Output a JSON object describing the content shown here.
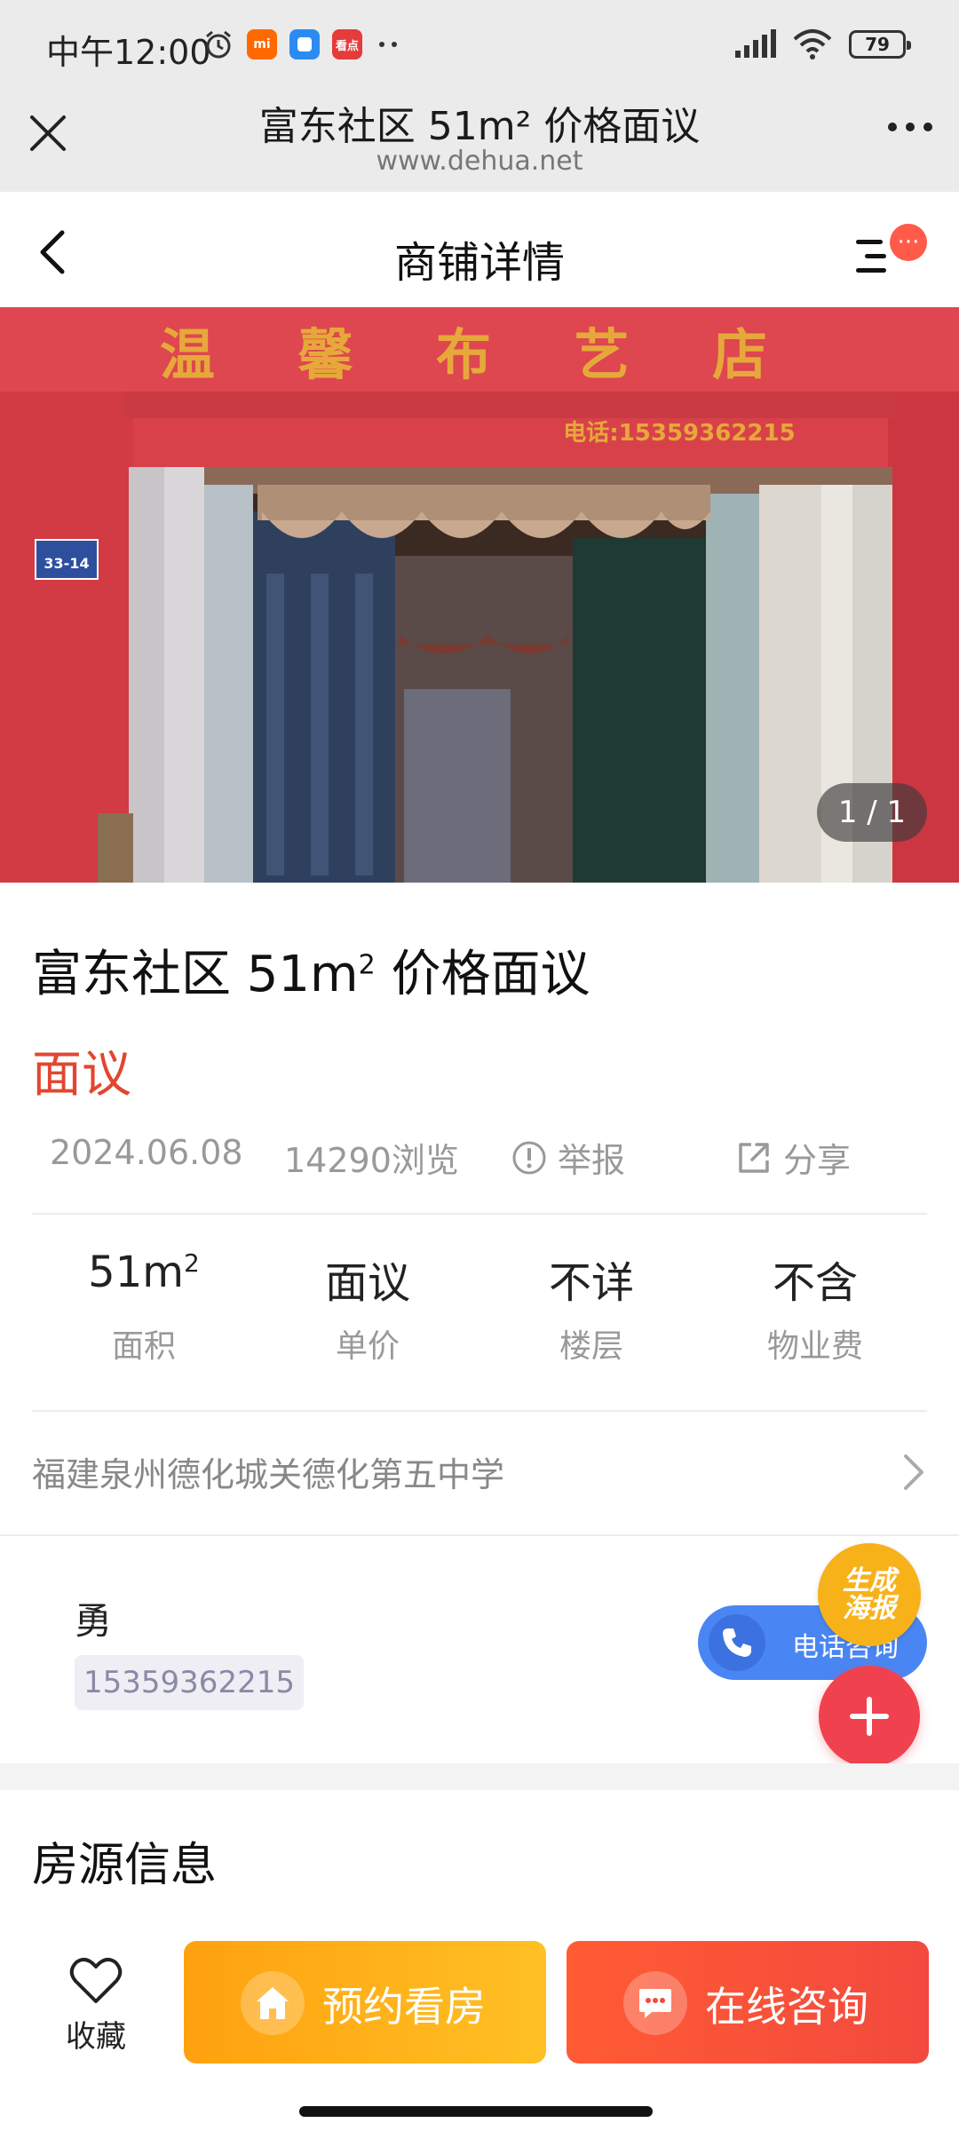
{
  "status_bar": {
    "time": "中午12:00",
    "apps": [
      {
        "icon": "mi-app-icon",
        "label": "mi",
        "color": "#ff6900"
      },
      {
        "icon": "blue-app-icon",
        "label": "",
        "color": "#2b8bf2"
      },
      {
        "icon": "kandian-app-icon",
        "label": "看点",
        "color": "#e63b3b"
      }
    ],
    "battery": "79"
  },
  "browser": {
    "title": "富东社区 51m² 价格面议",
    "url": "www.dehua.net"
  },
  "header": {
    "title": "商铺详情",
    "menu_badge": "···"
  },
  "hero": {
    "sign_text": "温 馨 布 艺 店",
    "sign_phone": "电话:15359362215",
    "street_plate": "33-14",
    "counter": "1 / 1"
  },
  "listing": {
    "title_prefix": "富东社区 51m",
    "title_sup": "2",
    "title_suffix": " 价格面议",
    "price": "面议",
    "date": "2024.06.08",
    "views": "14290浏览",
    "report_label": "举报",
    "share_label": "分享"
  },
  "specs": [
    {
      "value": "51m",
      "sup": "2",
      "label": "面积"
    },
    {
      "value": "面议",
      "sup": "",
      "label": "单价"
    },
    {
      "value": "不详",
      "sup": "",
      "label": "楼层"
    },
    {
      "value": "不含",
      "sup": "",
      "label": "物业费"
    }
  ],
  "address": "福建泉州德化城关德化第五中学",
  "contact": {
    "name": "勇",
    "phone": "15359362215",
    "call_label": "电话咨询",
    "poster_line1": "生成",
    "poster_line2": "海报"
  },
  "section": {
    "title": "房源信息"
  },
  "bottom_bar": {
    "favorite_label": "收藏",
    "appointment_label": "预约看房",
    "consult_label": "在线咨询"
  },
  "colors": {
    "accent_red": "#e2462f",
    "appointment_orange": "#ffa10f",
    "consult_red": "#f24a3e",
    "call_blue": "#4a86f3"
  }
}
